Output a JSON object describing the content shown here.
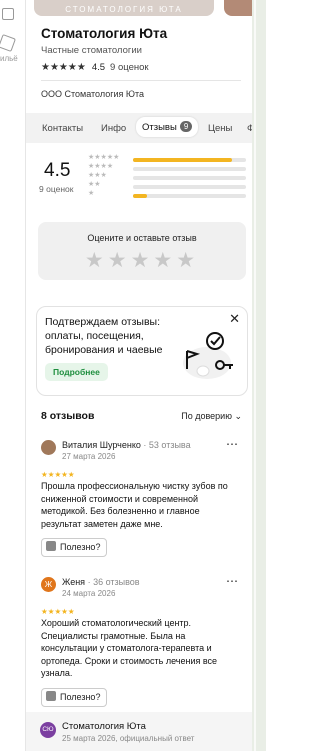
{
  "sidebar": {
    "label": "ильё"
  },
  "photos": {
    "main_caption": "СТОМАТОЛОГИЯ ЮТА"
  },
  "org": {
    "name": "Стоматология Юта",
    "category": "Частные стоматологии",
    "stars": "★★★★★",
    "rating": "4.5",
    "rating_count": "9 оценок",
    "legal_name": "ООО Стоматология Юта"
  },
  "tabs": [
    {
      "label": "Контакты"
    },
    {
      "label": "Инфо"
    },
    {
      "label": "Отзывы",
      "badge": "9"
    },
    {
      "label": "Цены"
    },
    {
      "label": "Фо"
    }
  ],
  "summary": {
    "score": "4.5",
    "count": "9 оценок",
    "distribution": [
      {
        "stars": "★★★★★",
        "fraction": 0.88
      },
      {
        "stars": "★★★★",
        "fraction": 0.0
      },
      {
        "stars": "★★★",
        "fraction": 0.0
      },
      {
        "stars": "★★",
        "fraction": 0.0
      },
      {
        "stars": "★",
        "fraction": 0.12
      }
    ]
  },
  "rate_prompt": {
    "title": "Оцените и оставьте отзыв",
    "stars": "★★★★★"
  },
  "promo": {
    "text": "Подтверждаем отзывы: оплаты, посещения, бронирования и чаевые",
    "button": "Подробнее",
    "close": "✕"
  },
  "reviews_header": {
    "title": "8 отзывов",
    "sort": "По доверию ⌄"
  },
  "reviews": [
    {
      "name": "Виталия Шурченко",
      "count": "53 отзыва",
      "date": "27 марта 2026",
      "stars": "★★★★★",
      "text": "Прошла профессиональную чистку зубов по сниженной стоимости и современной методикой. Без болезненно и главное результат заметен даже мне.",
      "useful": "Полезно?",
      "more": "⋯"
    },
    {
      "name": "Женя",
      "initial": "Ж",
      "count": "36 отзывов",
      "date": "24 марта 2026",
      "stars": "★★★★★",
      "text": "Хороший стоматологический центр. Специалисты грамотные. Была на консультации у стоматолога-терапевта и ортопеда. Сроки и стоимость лечения все узнала.",
      "useful": "Полезно?",
      "more": "⋯"
    }
  ],
  "owner_reply": {
    "initials": "СЮ",
    "name": "Стоматология Юта",
    "date": "25 марта 2026, официальный ответ"
  }
}
